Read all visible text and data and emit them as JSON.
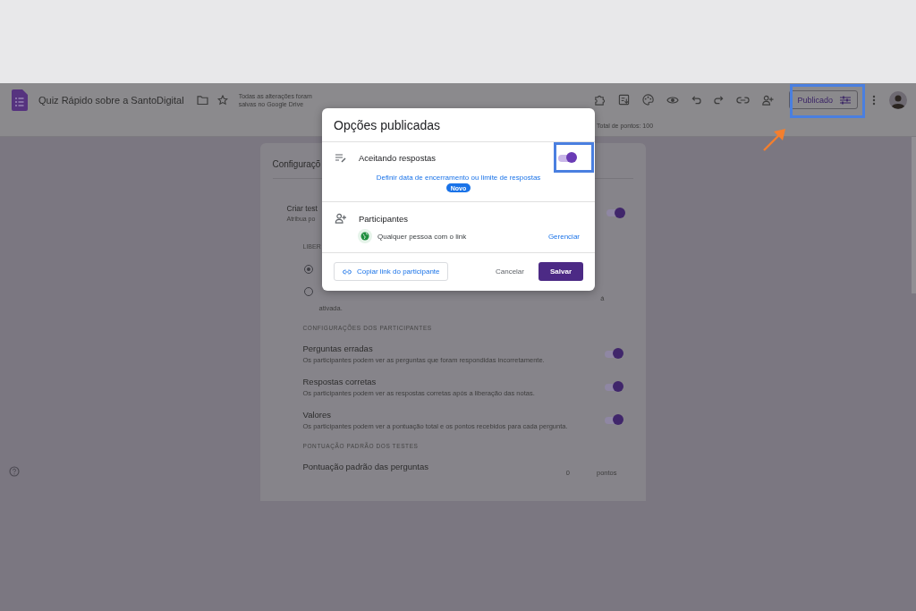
{
  "header": {
    "title": "Quiz Rápido sobre a SantoDigital",
    "save_status": "Todas as alterações foram salvas no Google Drive",
    "publish_button": "Publicado",
    "total_points": "Total de pontos: 100"
  },
  "settings_card": {
    "title": "Configuraçõ",
    "quiz_toggle": {
      "label": "Criar test",
      "description": "Atribua po",
      "on": true
    },
    "release_heading": "LIBER",
    "release_options": [
      {
        "selected": true
      },
      {
        "selected": false,
        "text_end": "á",
        "note": "ativada."
      }
    ],
    "participant_heading": "CONFIGURAÇÕES DOS PARTICIPANTES",
    "participant_settings": [
      {
        "label": "Perguntas erradas",
        "description": "Os participantes podem ver as perguntas que foram respondidas incorretamente.",
        "on": true
      },
      {
        "label": "Respostas corretas",
        "description": "Os participantes podem ver as respostas corretas após a liberação das notas.",
        "on": true
      },
      {
        "label": "Valores",
        "description": "Os participantes podem ver a pontuação total e os pontos recebidos para cada pergunta.",
        "on": true
      }
    ],
    "points_heading": "PONTUAÇÃO PADRÃO DOS TESTES",
    "default_points": {
      "label": "Pontuação padrão das perguntas",
      "value": "0",
      "unit": "pontos"
    }
  },
  "dialog": {
    "title": "Opções publicadas",
    "accepting": {
      "label": "Aceitando respostas",
      "on": true,
      "link": "Definir data de encerramento ou limite de respostas",
      "badge": "Novo"
    },
    "participants": {
      "title": "Participantes",
      "access": "Qualquer pessoa com o link",
      "manage": "Gerenciar"
    },
    "copy_link": "Copiar link do participante",
    "cancel": "Cancelar",
    "save": "Salvar"
  }
}
